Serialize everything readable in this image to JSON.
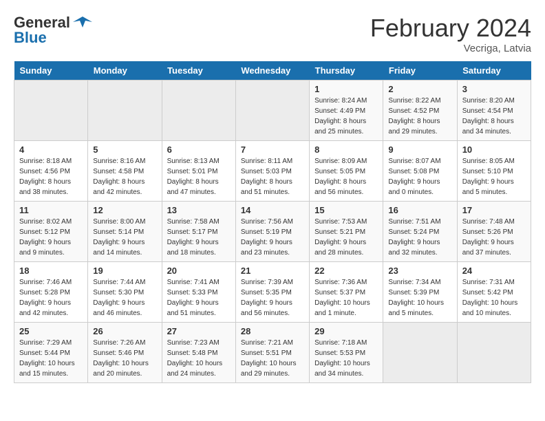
{
  "header": {
    "logo_general": "General",
    "logo_blue": "Blue",
    "month_title": "February 2024",
    "location": "Vecriga, Latvia"
  },
  "days_of_week": [
    "Sunday",
    "Monday",
    "Tuesday",
    "Wednesday",
    "Thursday",
    "Friday",
    "Saturday"
  ],
  "weeks": [
    [
      {
        "num": "",
        "info": "",
        "empty": true
      },
      {
        "num": "",
        "info": "",
        "empty": true
      },
      {
        "num": "",
        "info": "",
        "empty": true
      },
      {
        "num": "",
        "info": "",
        "empty": true
      },
      {
        "num": "1",
        "info": "Sunrise: 8:24 AM\nSunset: 4:49 PM\nDaylight: 8 hours\nand 25 minutes."
      },
      {
        "num": "2",
        "info": "Sunrise: 8:22 AM\nSunset: 4:52 PM\nDaylight: 8 hours\nand 29 minutes."
      },
      {
        "num": "3",
        "info": "Sunrise: 8:20 AM\nSunset: 4:54 PM\nDaylight: 8 hours\nand 34 minutes."
      }
    ],
    [
      {
        "num": "4",
        "info": "Sunrise: 8:18 AM\nSunset: 4:56 PM\nDaylight: 8 hours\nand 38 minutes."
      },
      {
        "num": "5",
        "info": "Sunrise: 8:16 AM\nSunset: 4:58 PM\nDaylight: 8 hours\nand 42 minutes."
      },
      {
        "num": "6",
        "info": "Sunrise: 8:13 AM\nSunset: 5:01 PM\nDaylight: 8 hours\nand 47 minutes."
      },
      {
        "num": "7",
        "info": "Sunrise: 8:11 AM\nSunset: 5:03 PM\nDaylight: 8 hours\nand 51 minutes."
      },
      {
        "num": "8",
        "info": "Sunrise: 8:09 AM\nSunset: 5:05 PM\nDaylight: 8 hours\nand 56 minutes."
      },
      {
        "num": "9",
        "info": "Sunrise: 8:07 AM\nSunset: 5:08 PM\nDaylight: 9 hours\nand 0 minutes."
      },
      {
        "num": "10",
        "info": "Sunrise: 8:05 AM\nSunset: 5:10 PM\nDaylight: 9 hours\nand 5 minutes."
      }
    ],
    [
      {
        "num": "11",
        "info": "Sunrise: 8:02 AM\nSunset: 5:12 PM\nDaylight: 9 hours\nand 9 minutes."
      },
      {
        "num": "12",
        "info": "Sunrise: 8:00 AM\nSunset: 5:14 PM\nDaylight: 9 hours\nand 14 minutes."
      },
      {
        "num": "13",
        "info": "Sunrise: 7:58 AM\nSunset: 5:17 PM\nDaylight: 9 hours\nand 18 minutes."
      },
      {
        "num": "14",
        "info": "Sunrise: 7:56 AM\nSunset: 5:19 PM\nDaylight: 9 hours\nand 23 minutes."
      },
      {
        "num": "15",
        "info": "Sunrise: 7:53 AM\nSunset: 5:21 PM\nDaylight: 9 hours\nand 28 minutes."
      },
      {
        "num": "16",
        "info": "Sunrise: 7:51 AM\nSunset: 5:24 PM\nDaylight: 9 hours\nand 32 minutes."
      },
      {
        "num": "17",
        "info": "Sunrise: 7:48 AM\nSunset: 5:26 PM\nDaylight: 9 hours\nand 37 minutes."
      }
    ],
    [
      {
        "num": "18",
        "info": "Sunrise: 7:46 AM\nSunset: 5:28 PM\nDaylight: 9 hours\nand 42 minutes."
      },
      {
        "num": "19",
        "info": "Sunrise: 7:44 AM\nSunset: 5:30 PM\nDaylight: 9 hours\nand 46 minutes."
      },
      {
        "num": "20",
        "info": "Sunrise: 7:41 AM\nSunset: 5:33 PM\nDaylight: 9 hours\nand 51 minutes."
      },
      {
        "num": "21",
        "info": "Sunrise: 7:39 AM\nSunset: 5:35 PM\nDaylight: 9 hours\nand 56 minutes."
      },
      {
        "num": "22",
        "info": "Sunrise: 7:36 AM\nSunset: 5:37 PM\nDaylight: 10 hours\nand 1 minute."
      },
      {
        "num": "23",
        "info": "Sunrise: 7:34 AM\nSunset: 5:39 PM\nDaylight: 10 hours\nand 5 minutes."
      },
      {
        "num": "24",
        "info": "Sunrise: 7:31 AM\nSunset: 5:42 PM\nDaylight: 10 hours\nand 10 minutes."
      }
    ],
    [
      {
        "num": "25",
        "info": "Sunrise: 7:29 AM\nSunset: 5:44 PM\nDaylight: 10 hours\nand 15 minutes."
      },
      {
        "num": "26",
        "info": "Sunrise: 7:26 AM\nSunset: 5:46 PM\nDaylight: 10 hours\nand 20 minutes."
      },
      {
        "num": "27",
        "info": "Sunrise: 7:23 AM\nSunset: 5:48 PM\nDaylight: 10 hours\nand 24 minutes."
      },
      {
        "num": "28",
        "info": "Sunrise: 7:21 AM\nSunset: 5:51 PM\nDaylight: 10 hours\nand 29 minutes."
      },
      {
        "num": "29",
        "info": "Sunrise: 7:18 AM\nSunset: 5:53 PM\nDaylight: 10 hours\nand 34 minutes."
      },
      {
        "num": "",
        "info": "",
        "empty": true
      },
      {
        "num": "",
        "info": "",
        "empty": true
      }
    ]
  ]
}
